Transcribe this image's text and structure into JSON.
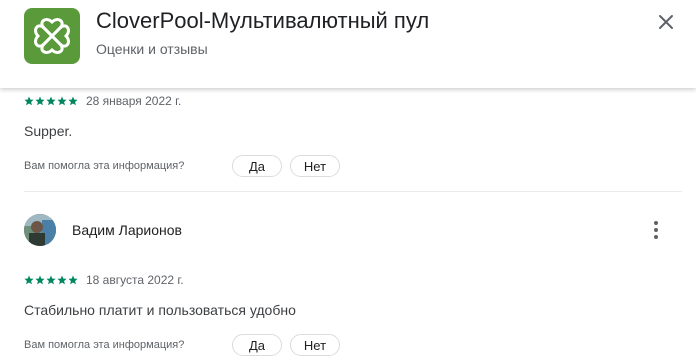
{
  "header": {
    "title": "CloverPool-Мультивалютный пул",
    "subtitle": "Оценки и отзывы",
    "icon": "app-logo",
    "close_icon": "close-icon",
    "brand_color": "#5a9a3a"
  },
  "reviews": [
    {
      "rating": 5,
      "date": "28 января 2022 г.",
      "text": "Supper.",
      "helpful_question": "Вам помогла эта информация?",
      "yes_label": "Да",
      "no_label": "Нет"
    },
    {
      "author": "Вадим Ларионов",
      "rating": 5,
      "date": "18 августа 2022 г.",
      "text": "Стабильно платит и пользоваться удобно",
      "helpful_question": "Вам помогла эта информация?",
      "yes_label": "Да",
      "no_label": "Нет"
    }
  ],
  "star_color": "#01875f"
}
